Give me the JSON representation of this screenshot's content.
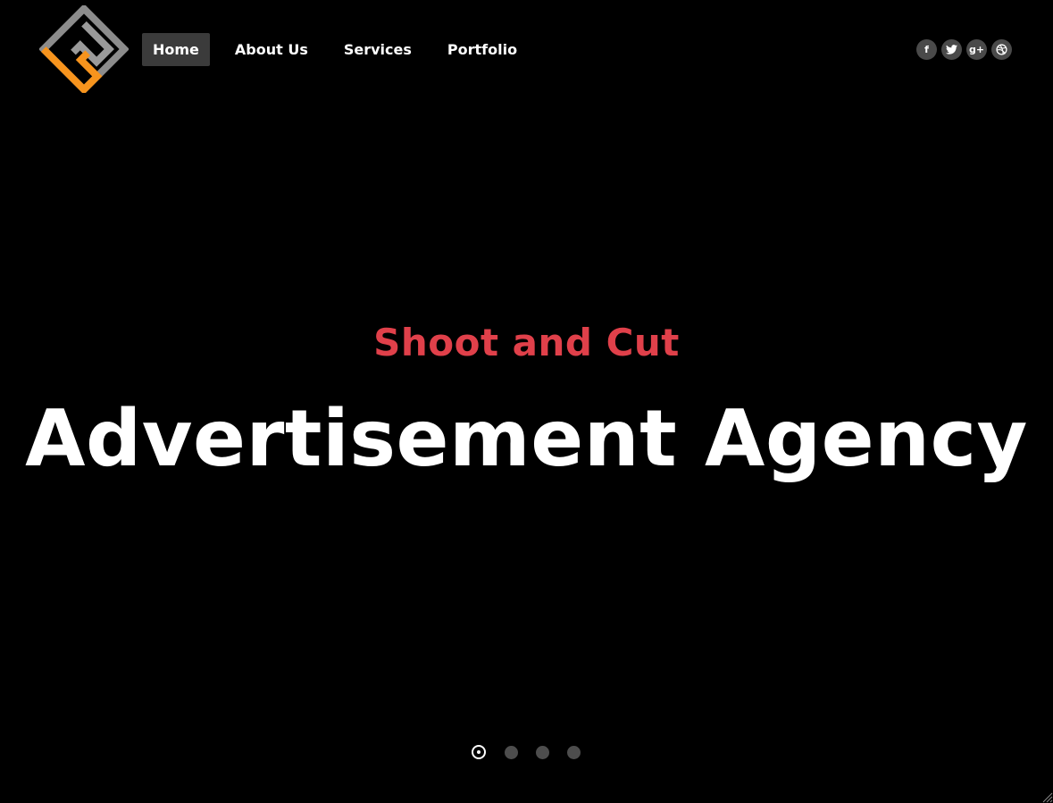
{
  "header": {
    "logo": {
      "icon": "maze-diamond-logo-icon",
      "colors": [
        "#8c8c8c",
        "#f7941d"
      ]
    },
    "nav": [
      {
        "label": "Home",
        "active": true
      },
      {
        "label": "About Us",
        "active": false
      },
      {
        "label": "Services",
        "active": false
      },
      {
        "label": "Portfolio",
        "active": false
      }
    ],
    "social": [
      {
        "icon": "facebook-icon",
        "glyph": "f"
      },
      {
        "icon": "twitter-icon",
        "glyph": ""
      },
      {
        "icon": "google-plus-icon",
        "glyph": "g+"
      },
      {
        "icon": "dribbble-icon",
        "glyph": ""
      }
    ]
  },
  "hero": {
    "subtitle": "Shoot and Cut",
    "title": "Advertisement Agency"
  },
  "slider": {
    "total_slides": 4,
    "active_index": 0
  },
  "colors": {
    "background": "#000000",
    "accent": "#e0404a",
    "nav_active_bg": "#3b3b3b",
    "dot_inactive": "#4d4d4d"
  }
}
